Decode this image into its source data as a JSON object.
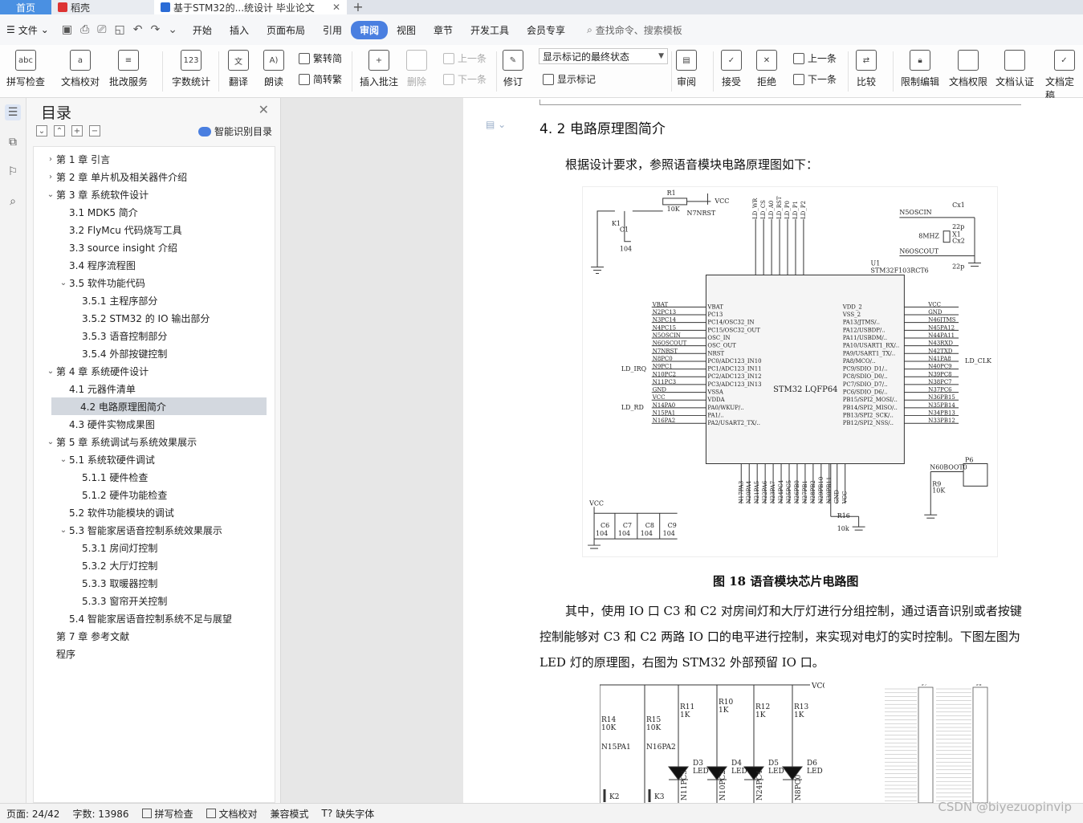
{
  "tabs": {
    "home": "首页",
    "daoke": "稻壳",
    "doc": "基于STM32的...统设计 毕业论文"
  },
  "menu": {
    "file": "文件",
    "tabs": [
      "开始",
      "插入",
      "页面布局",
      "引用",
      "审阅",
      "视图",
      "章节",
      "开发工具",
      "会员专享"
    ],
    "active_tab": "审阅",
    "search": "查找命令、搜索模板"
  },
  "ribbon": {
    "spell": "拼写检查",
    "proof": "文档校对",
    "batch": "批改服务",
    "wordcount": "字数统计",
    "translate": "翻译",
    "read": "朗读",
    "trad": "繁转简",
    "simp": "简转繁",
    "comment": "插入批注",
    "delete": "删除",
    "prev_comment": "上一条",
    "next_comment": "下一条",
    "revise": "修订",
    "final_state": "显示标记的最终状态",
    "show_marks": "显示标记",
    "review": "审阅",
    "accept": "接受",
    "reject": "拒绝",
    "prev": "上一条",
    "next": "下一条",
    "compare": "比较",
    "restrict": "限制编辑",
    "perm": "文档权限",
    "cert": "文档认证",
    "final": "文档定稿"
  },
  "toc": {
    "title": "目录",
    "ai": "智能识别目录",
    "items": [
      {
        "label": "第 1 章  引言",
        "level": 0,
        "chev": "›"
      },
      {
        "label": "第 2 章  单片机及相关器件介绍",
        "level": 0,
        "chev": "›"
      },
      {
        "label": "第 3 章  系统软件设计",
        "level": 0,
        "chev": "⌄"
      },
      {
        "label": "3.1 MDK5 简介",
        "level": 1,
        "chev": ""
      },
      {
        "label": "3.2 FlyMcu 代码烧写工具",
        "level": 1,
        "chev": ""
      },
      {
        "label": "3.3 source insight  介绍",
        "level": 1,
        "chev": ""
      },
      {
        "label": "3.4  程序流程图",
        "level": 1,
        "chev": ""
      },
      {
        "label": "3.5  软件功能代码",
        "level": 1,
        "chev": "⌄"
      },
      {
        "label": "3.5.1  主程序部分",
        "level": 2,
        "chev": ""
      },
      {
        "label": "3.5.2 STM32 的 IO 输出部分",
        "level": 2,
        "chev": ""
      },
      {
        "label": "3.5.3  语音控制部分",
        "level": 2,
        "chev": ""
      },
      {
        "label": "3.5.4  外部按键控制",
        "level": 2,
        "chev": ""
      },
      {
        "label": "第 4 章  系统硬件设计",
        "level": 0,
        "chev": "⌄"
      },
      {
        "label": "4.1  元器件清单",
        "level": 1,
        "chev": ""
      },
      {
        "label": "4.2  电路原理图简介",
        "level": 1,
        "chev": "",
        "selected": true
      },
      {
        "label": "4.3 硬件实物成果图",
        "level": 1,
        "chev": ""
      },
      {
        "label": "第 5 章  系统调试与系统效果展示",
        "level": 0,
        "chev": "⌄"
      },
      {
        "label": "5.1  系统软硬件调试",
        "level": 1,
        "chev": "⌄"
      },
      {
        "label": "5.1.1 硬件检查",
        "level": 2,
        "chev": ""
      },
      {
        "label": "5.1.2  硬件功能检查",
        "level": 2,
        "chev": ""
      },
      {
        "label": "5.2  软件功能模块的调试",
        "level": 1,
        "chev": ""
      },
      {
        "label": "5.3  智能家居语音控制系统效果展示",
        "level": 1,
        "chev": "⌄"
      },
      {
        "label": "5.3.1  房间灯控制",
        "level": 2,
        "chev": ""
      },
      {
        "label": "5.3.2  大厅灯控制",
        "level": 2,
        "chev": ""
      },
      {
        "label": "5.3.3  取暖器控制",
        "level": 2,
        "chev": ""
      },
      {
        "label": "5.3.3  窗帘开关控制",
        "level": 2,
        "chev": ""
      },
      {
        "label": "5.4  智能家居语音控制系统不足与展望",
        "level": 1,
        "chev": ""
      },
      {
        "label": "第 7 章  参考文献",
        "level": 0,
        "chev": ""
      },
      {
        "label": "程序",
        "level": 0,
        "chev": ""
      }
    ]
  },
  "doc": {
    "heading": "4. 2  电路原理图简介",
    "intro": "根据设计要求，参照语音模块电路原理图如下：",
    "caption": "图 18  语音模块芯片电路图",
    "p1": "其中，使用 IO 口 C3 和 C2 对房间灯和大厅灯进行分组控制，通过语音识别或者按键",
    "p2": "控制能够对 C3 和 C2 两路 IO 口的电平进行控制，来实现对电灯的实时控制。下图左图为",
    "p3": "LED 灯的原理图，右图为 STM32 外部预留 IO 口。",
    "schematic": {
      "chip": "STM32 LQFP64",
      "u1": "U1",
      "u1_part": "STM32F103RCT6",
      "r1": "R1",
      "r1_val": "10K",
      "vcc": "VCC",
      "n7nrst": "N7NRST",
      "k1": "K1",
      "c1": "C1",
      "c1_val": "104",
      "n5oscin": "N5OSCIN",
      "n6oscout": "N6OSCOUT",
      "cx1": "Cx1",
      "cx2": "Cx2",
      "x1": "X1",
      "mhz": "8MHZ",
      "p22": "22p",
      "ld_clk": "LD_CLK",
      "ld_irq": "LD_IRQ",
      "ld_rd": "LD_RD",
      "p6": "P6",
      "n60boot0": "N60BOOT0",
      "r9": "R9",
      "r9_val": "10K",
      "r16": "R16",
      "r16_val": "10k",
      "c6": "C6",
      "c7": "C7",
      "c8": "C8",
      "c9": "C9",
      "cval": "104",
      "left_pins": [
        "VBAT",
        "N2PC13",
        "N3PC14",
        "N4PC15",
        "N5OSCIN",
        "N6OSCOUT",
        "N7NRST",
        "N8PC0",
        "N9PC1",
        "N10PC2",
        "N11PC3",
        "GND",
        "VCC",
        "N14PA0",
        "N15PA1",
        "N16PA2"
      ],
      "left_inner": [
        "VBAT",
        "PC13",
        "PC14/OSC32_IN",
        "PC15/OSC32_OUT",
        "OSC_IN",
        "OSC_OUT",
        "NRST",
        "PC0/ADC123_IN10",
        "PC1/ADC123_IN11",
        "PC2/ADC123_IN12",
        "PC3/ADC123_IN13",
        "VSSA",
        "VDDA",
        "PA0/WKUP/..",
        "PA1/..",
        "PA2/USART2_TX/.."
      ],
      "right_pins": [
        "VCC",
        "GND",
        "N46JTMS",
        "N45PA12",
        "N44PA11",
        "N43RXD",
        "N42TXD",
        "N41PA8",
        "N40PC9",
        "N39PC8",
        "N38PC7",
        "N37PC6",
        "N36PB15",
        "N35PB14",
        "N34PB13",
        "N33PB12"
      ],
      "right_inner": [
        "VDD_2",
        "VSS_2",
        "PA13/JTMS/..",
        "PA12/USBDP/..",
        "PA11/USBDM/..",
        "PA10/USART1_RX/..",
        "PA9/USART1_TX/..",
        "PA8/MCO/..",
        "PC9/SDIO_D1/..",
        "PC8/SDIO_D0/..",
        "PC7/SDIO_D7/..",
        "PC6/SDIO_D6/..",
        "PB15/SPI2_MOSI/..",
        "PB14/SPI2_MISO/..",
        "PB13/SPI2_SCK/..",
        "PB12/SPI2_NSS/.."
      ],
      "top_labels": [
        "LD_WR",
        "LD_CS",
        "LD_A0",
        "LD_RST",
        "LD_P0",
        "LD_P1",
        "LD_P2"
      ],
      "bottom_labels": [
        "N17PA3",
        "N20PA4",
        "N21PA5",
        "N22PA6",
        "N23PA7",
        "N24PC4",
        "N25PC5",
        "N26PB0",
        "N27PB1",
        "N28PB2",
        "N29PB10",
        "N30PB11",
        "GND",
        "VCC"
      ]
    },
    "led": {
      "vcc": "VCC",
      "r14": "R14",
      "r15": "R15",
      "r11": "R11",
      "r10": "R10",
      "r12": "R12",
      "r13": "R13",
      "k10": "10K",
      "k1": "1K",
      "n15": "N15PA1",
      "n16": "N16PA2",
      "d3": "D3",
      "d4": "D4",
      "d5": "D5",
      "d6": "D6",
      "led": "LED",
      "k2": "K2",
      "k3": "K3",
      "pc3": "N11PC3",
      "pc2": "N10PC2",
      "pc4": "N24PC4",
      "pc0": "N8PC0"
    },
    "io": {
      "p7": "P7",
      "p8": "P8"
    }
  },
  "status": {
    "page": "页面: 24/42",
    "words": "字数: 13986",
    "spell": "拼写检查",
    "proof": "文档校对",
    "compat": "兼容模式",
    "font": "缺失字体"
  },
  "watermark": "CSDN @biyezuopinvip"
}
